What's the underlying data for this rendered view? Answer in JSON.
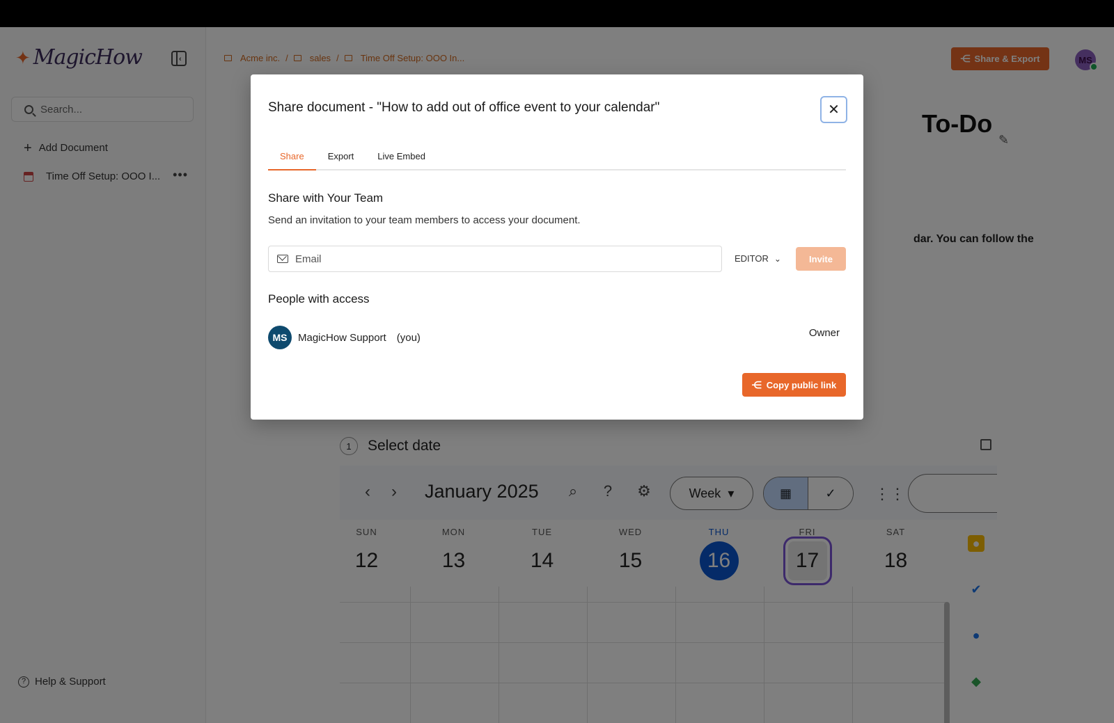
{
  "sidebar": {
    "logo_text": "MagicHow",
    "search_placeholder": "Search...",
    "add_document": "Add Document",
    "doc_item": "Time Off Setup: OOO I...",
    "more": "•••",
    "help": "Help & Support"
  },
  "header": {
    "breadcrumb": [
      "Acme inc.",
      "sales",
      "Time Off Setup: OOO In..."
    ],
    "share_export": "Share & Export",
    "avatar_initials": "MS"
  },
  "doc": {
    "title_fragment": "To-Do",
    "body_fragment": "dar. You can follow the",
    "step_number": "1",
    "step_title": "Select date"
  },
  "calendar": {
    "month": "January 2025",
    "view": "Week",
    "days": [
      {
        "name": "SUN",
        "num": "12"
      },
      {
        "name": "MON",
        "num": "13"
      },
      {
        "name": "TUE",
        "num": "14"
      },
      {
        "name": "WED",
        "num": "15"
      },
      {
        "name": "THU",
        "num": "16"
      },
      {
        "name": "FRI",
        "num": "17"
      },
      {
        "name": "SAT",
        "num": "18"
      }
    ]
  },
  "modal": {
    "title": "Share document - \"How to add out of office event to your calendar\"",
    "tabs": [
      "Share",
      "Export",
      "Live Embed"
    ],
    "section_share_title": "Share with Your Team",
    "section_share_desc": "Send an invitation to your team members to access your document.",
    "email_placeholder": "Email",
    "role": "EDITOR",
    "invite": "Invite",
    "access_title": "People with access",
    "person": {
      "initials": "MS",
      "name": "MagicHow Support",
      "you": "(you)",
      "role": "Owner"
    },
    "copy_link": "Copy public link"
  },
  "colors": {
    "accent": "#e8672a",
    "today": "#0b57d0"
  }
}
